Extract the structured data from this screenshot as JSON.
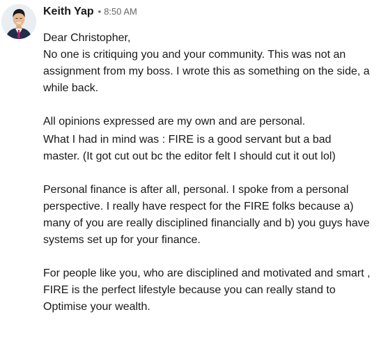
{
  "message": {
    "sender": "Keith Yap",
    "separator": "•",
    "time": "8:50 AM",
    "avatar_icon": "person-avatar",
    "lines": {
      "greeting": "Dear Christopher,",
      "p1": "No one is critiquing you and your community. This was not an assignment from my boss. I wrote this as something on the side, a while back.",
      "p2": "All opinions expressed are my own and are personal.",
      "p3": "What I had in mind was : FIRE is a good servant but a bad master. (It got cut out bc the editor felt I should cut it out lol)",
      "p4": "Personal finance is after all, personal. I spoke from a personal perspective. I really have respect for the FIRE folks because a) many of you are really disciplined financially and b) you guys have systems set up for your finance.",
      "p5": "For people like you, who are disciplined and motivated and smart , FIRE is the perfect lifestyle because you can really stand to Optimise your wealth."
    }
  },
  "colors": {
    "text": "#191919",
    "muted": "#666666",
    "background": "#ffffff"
  }
}
